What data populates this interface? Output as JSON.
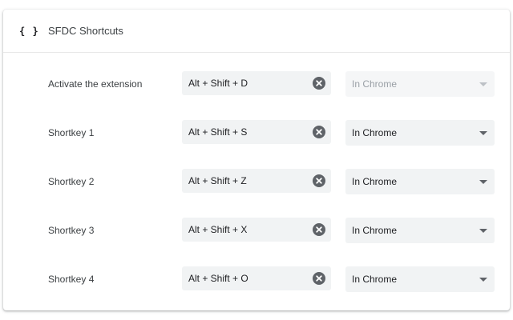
{
  "extension": {
    "icon": "braces-icon",
    "icon_text": "{ }",
    "name": "SFDC Shortcuts"
  },
  "clear_icon": "close-circle-icon",
  "rows": [
    {
      "label": "Activate the extension",
      "shortcut": "Alt + Shift + D",
      "scope": "In Chrome",
      "scope_disabled": true
    },
    {
      "label": "Shortkey 1",
      "shortcut": "Alt + Shift + S",
      "scope": "In Chrome",
      "scope_disabled": false
    },
    {
      "label": "Shortkey 2",
      "shortcut": "Alt + Shift + Z",
      "scope": "In Chrome",
      "scope_disabled": false
    },
    {
      "label": "Shortkey 3",
      "shortcut": "Alt + Shift + X",
      "scope": "In Chrome",
      "scope_disabled": false
    },
    {
      "label": "Shortkey 4",
      "shortcut": "Alt + Shift + O",
      "scope": "In Chrome",
      "scope_disabled": false
    }
  ]
}
